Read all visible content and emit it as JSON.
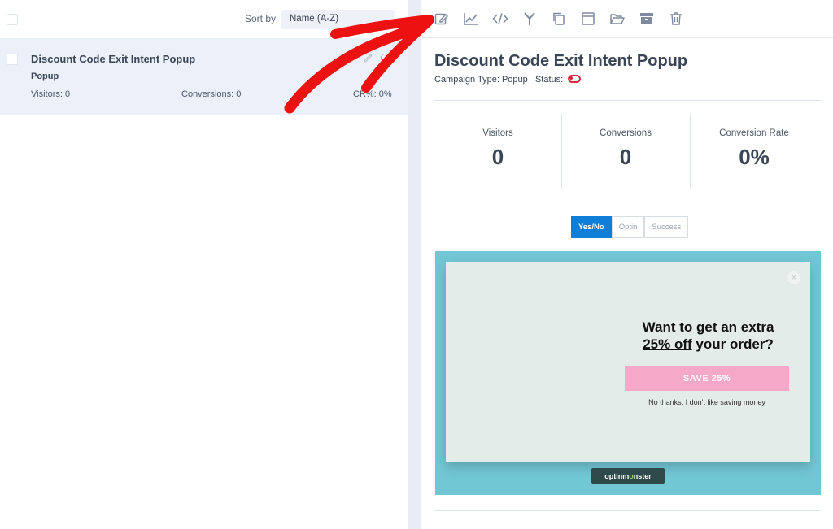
{
  "list": {
    "sort_label": "Sort by",
    "sort_value": "Name (A-Z)",
    "campaign": {
      "title": "Discount Code Exit Intent Popup",
      "type": "Popup",
      "visitors_label": "Visitors:",
      "visitors": "0",
      "conversions_label": "Conversions:",
      "conversions": "0",
      "cr_label": "CR%:",
      "cr": "0%"
    }
  },
  "toolbar": {
    "icons": [
      "edit-icon",
      "analytics-icon",
      "embed-code-icon",
      "split-test-icon",
      "duplicate-icon",
      "template-icon",
      "folder-icon",
      "archive-icon",
      "trash-icon"
    ],
    "icon_color": "#7d8aa0"
  },
  "detail": {
    "title": "Discount Code Exit Intent Popup",
    "campaign_type_label": "Campaign Type:",
    "campaign_type": "Popup",
    "status_label": "Status:",
    "status_color": "#d7263d",
    "stats": [
      {
        "label": "Visitors",
        "value": "0"
      },
      {
        "label": "Conversions",
        "value": "0"
      },
      {
        "label": "Conversion Rate",
        "value": "0%"
      }
    ],
    "tabs": [
      "Yes/No",
      "Optin",
      "Success"
    ],
    "active_tab": "Yes/No",
    "accent_color": "#0f7ed8"
  },
  "preview": {
    "heading_line1": "Want to get an extra",
    "heading_underlined": "25% off",
    "heading_rest": " your order?",
    "cta": "SAVE 25%",
    "decline": "No thanks, I don't like saving money",
    "close": "×",
    "brand_prefix": "optinm",
    "brand_o": "o",
    "brand_suffix": "nster",
    "background_color": "#72c7d5",
    "cta_color": "#f5a8c8"
  }
}
